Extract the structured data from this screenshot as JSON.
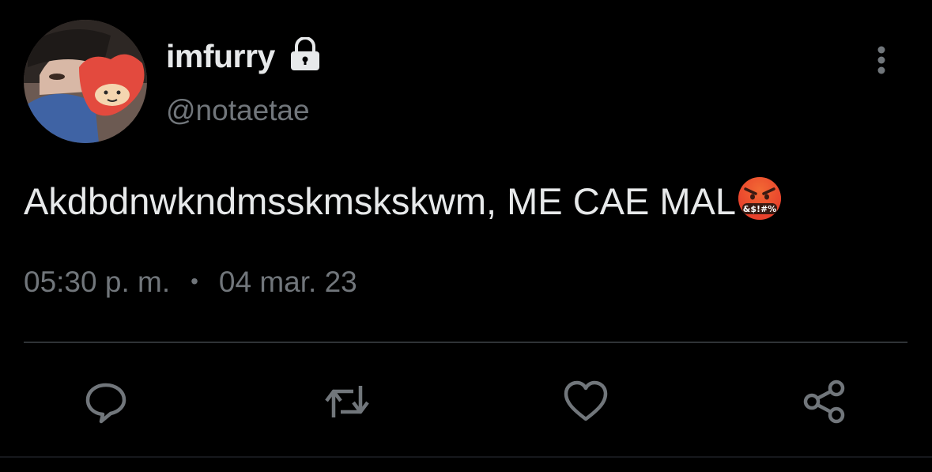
{
  "tweet": {
    "author": {
      "display_name": "imfurry",
      "handle": "@notaetae",
      "protected_icon": "lock-icon",
      "avatar": "avatar"
    },
    "text": "Akdbdnwkndmsskmskskwm, ME CAE MAL",
    "text_emoji": "face-with-symbols-on-mouth-emoji",
    "time": "05:30 p. m.",
    "separator": "•",
    "date": "04 mar. 23"
  },
  "actions": [
    "reply-icon",
    "retweet-icon",
    "like-icon",
    "share-icon"
  ],
  "more_menu_icon": "more-vertical-icon",
  "colors": {
    "background": "#000000",
    "primary_text": "#e7e9ea",
    "secondary_text": "#71767b",
    "divider": "#2f3336"
  }
}
